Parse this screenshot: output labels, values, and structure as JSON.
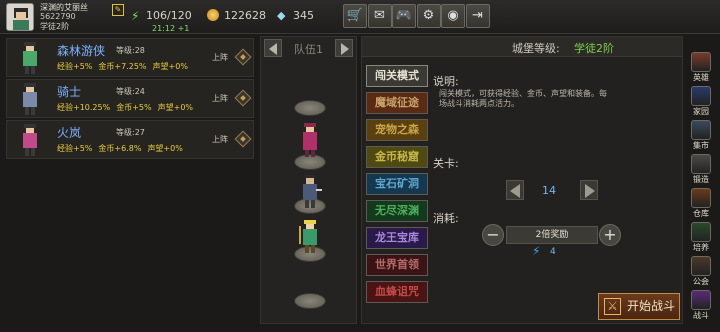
{
  "player": {
    "name": "深渊的艾丽丝",
    "id": "5622790",
    "rank": "学徒2阶"
  },
  "resources": {
    "energy": "106/120",
    "timer": "21:12 +1",
    "gold": "122628",
    "gems": "345"
  },
  "toolbar": [
    {
      "name": "shop-cart-button",
      "icon": "cart-icon",
      "glyph": "🛒"
    },
    {
      "name": "mail-button",
      "icon": "mail-icon",
      "glyph": "✉"
    },
    {
      "name": "gamepad-button",
      "icon": "gamepad-icon",
      "glyph": "🎮"
    },
    {
      "name": "settings-button",
      "icon": "gear-icon",
      "glyph": "⚙"
    },
    {
      "name": "color-wheel-button",
      "icon": "color-wheel-icon",
      "glyph": "◉"
    },
    {
      "name": "exit-button",
      "icon": "exit-icon",
      "glyph": "⇥"
    }
  ],
  "heroes": [
    {
      "name": "森林游侠",
      "level": "等级:28",
      "bonus": [
        "经验+5%",
        "金币+7.25%",
        "声望+0%"
      ],
      "action": "上阵",
      "color": "#4ba86a"
    },
    {
      "name": "骑士",
      "level": "等级:24",
      "bonus": [
        "经验+10.25%",
        "金币+5%",
        "声望+0%"
      ],
      "action": "上阵",
      "color": "#7a8aa8"
    },
    {
      "name": "火岚",
      "level": "等级:27",
      "bonus": [
        "经验+5%",
        "金币+6.8%",
        "声望+0%"
      ],
      "action": "上阵",
      "color": "#c04a8a"
    }
  ],
  "team": {
    "label": "队伍1"
  },
  "castle": {
    "label": "城堡等级:",
    "value": "学徒2阶"
  },
  "modes": [
    {
      "label": "闯关模式",
      "bg": "#3a3934",
      "fg": "#e8e2d2"
    },
    {
      "label": "魔域征途",
      "bg": "#5a2a14",
      "fg": "#c9a16a"
    },
    {
      "label": "宠物之森",
      "bg": "#5a4010",
      "fg": "#c9a44a"
    },
    {
      "label": "金币秘窟",
      "bg": "#4f4a12",
      "fg": "#c8b84a"
    },
    {
      "label": "宝石矿洞",
      "bg": "#14384f",
      "fg": "#5fa6cc"
    },
    {
      "label": "无尽深渊",
      "bg": "#143a1e",
      "fg": "#4fae5c"
    },
    {
      "label": "龙王宝库",
      "bg": "#2a1a4a",
      "fg": "#a888d8"
    },
    {
      "label": "世界首领",
      "bg": "#3a1414",
      "fg": "#b46a6a"
    },
    {
      "label": "血蜂诅咒",
      "bg": "#4a1414",
      "fg": "#c04a4a"
    }
  ],
  "description": {
    "title": "说明:",
    "text": "闯关模式，可获得经验、金币、声望和装备。每场战斗消耗两点活力。"
  },
  "stage": {
    "label": "关卡:",
    "value": "14"
  },
  "cost": {
    "label": "消耗:",
    "option": "2倍奖励",
    "value": "4"
  },
  "start_button": "开始战斗",
  "side_nav": [
    {
      "label": "英雄",
      "color": "#7a3a2a"
    },
    {
      "label": "家园",
      "color": "#2a3a6a"
    },
    {
      "label": "集市",
      "color": "#3a4a5a"
    },
    {
      "label": "锻造",
      "color": "#4a4a4a"
    },
    {
      "label": "仓库",
      "color": "#6a3a1a"
    },
    {
      "label": "培养",
      "color": "#2a4a2a"
    },
    {
      "label": "公会",
      "color": "#4a3a2a"
    },
    {
      "label": "战斗",
      "color": "#5a2a7a"
    }
  ]
}
